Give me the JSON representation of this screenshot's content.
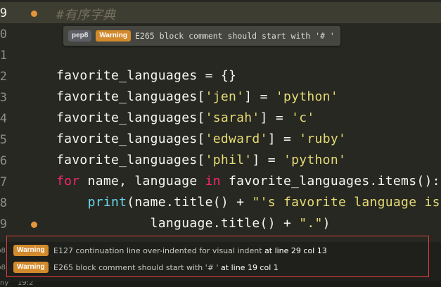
{
  "editor": {
    "lines": [
      {
        "num": "9",
        "cur": true,
        "dot": true,
        "tokens": [
          {
            "t": "#有序字典",
            "c": "cm"
          }
        ]
      },
      {
        "num": "0",
        "cur": false,
        "dot": false,
        "tokens": []
      },
      {
        "num": "1",
        "cur": false,
        "dot": false,
        "tokens": []
      },
      {
        "num": "2",
        "cur": false,
        "dot": false,
        "tokens": [
          {
            "t": "favorite_languages = {}",
            "c": ""
          }
        ]
      },
      {
        "num": "3",
        "cur": false,
        "dot": false,
        "tokens": [
          {
            "t": "favorite_languages[",
            "c": ""
          },
          {
            "t": "'jen'",
            "c": "str"
          },
          {
            "t": "] = ",
            "c": ""
          },
          {
            "t": "'python'",
            "c": "str"
          }
        ]
      },
      {
        "num": "4",
        "cur": false,
        "dot": false,
        "tokens": [
          {
            "t": "favorite_languages[",
            "c": ""
          },
          {
            "t": "'sarah'",
            "c": "str"
          },
          {
            "t": "] = ",
            "c": ""
          },
          {
            "t": "'c'",
            "c": "str"
          }
        ]
      },
      {
        "num": "5",
        "cur": false,
        "dot": false,
        "tokens": [
          {
            "t": "favorite_languages[",
            "c": ""
          },
          {
            "t": "'edward'",
            "c": "str"
          },
          {
            "t": "] = ",
            "c": ""
          },
          {
            "t": "'ruby'",
            "c": "str"
          }
        ]
      },
      {
        "num": "6",
        "cur": false,
        "dot": false,
        "tokens": [
          {
            "t": "favorite_languages[",
            "c": ""
          },
          {
            "t": "'phil'",
            "c": "str"
          },
          {
            "t": "] = ",
            "c": ""
          },
          {
            "t": "'python'",
            "c": "str"
          }
        ]
      },
      {
        "num": "7",
        "cur": false,
        "dot": false,
        "tokens": [
          {
            "t": "for",
            "c": "kw"
          },
          {
            "t": " name, language ",
            "c": ""
          },
          {
            "t": "in",
            "c": "kw"
          },
          {
            "t": " favorite_languages.items():",
            "c": ""
          }
        ]
      },
      {
        "num": "8",
        "cur": false,
        "dot": false,
        "tokens": [
          {
            "t": "    ",
            "c": ""
          },
          {
            "t": "print",
            "c": "fn"
          },
          {
            "t": "(name.title() + ",
            "c": ""
          },
          {
            "t": "\"'s favorite language is",
            "c": "str"
          }
        ]
      },
      {
        "num": "9",
        "cur": false,
        "dot": true,
        "tokens": [
          {
            "t": "            language.title() + ",
            "c": ""
          },
          {
            "t": "\".\"",
            "c": "str"
          },
          {
            "t": ")",
            "c": ""
          }
        ]
      }
    ]
  },
  "tooltip": {
    "source": "pep8",
    "level": "Warning",
    "message": "E265 block comment should start with '# '"
  },
  "panel": {
    "rows": [
      {
        "source": "p8",
        "level": "Warning",
        "message": "E127 continuation line over-indented for visual indent",
        "location": " at line 29 col 13"
      },
      {
        "source": "p8",
        "level": "Warning",
        "message": "E265 block comment should start with '# '",
        "location": " at line 19 col 1"
      }
    ]
  },
  "status": {
    "text": "ny    19:2"
  },
  "colors": {
    "background": "#272822",
    "warning": "#d38a2c",
    "error_outline": "#e23d3d",
    "string": "#e6db74",
    "keyword": "#f92672",
    "builtin": "#66d9ef",
    "comment": "#75715e"
  }
}
